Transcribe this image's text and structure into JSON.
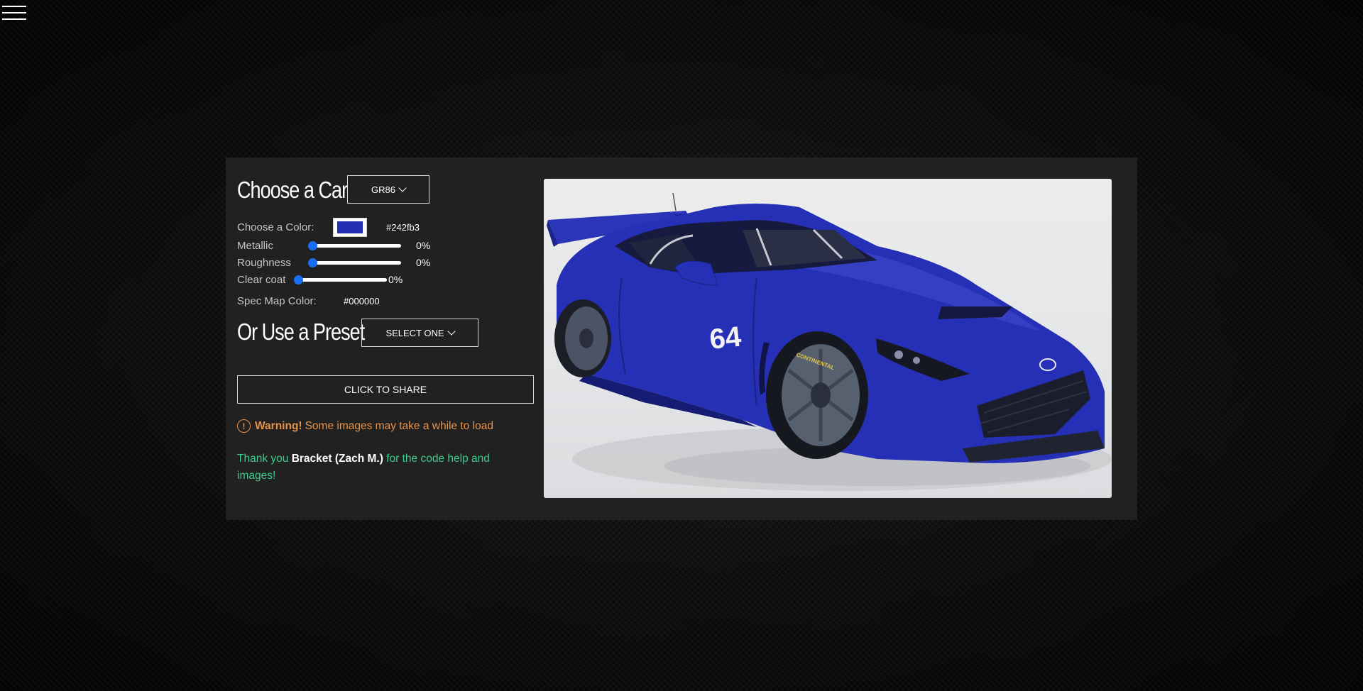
{
  "menu": {
    "icon": "hamburger-menu-icon"
  },
  "car": {
    "heading": "Choose a Car",
    "selected": "GR86"
  },
  "color": {
    "label": "Choose a Color:",
    "value": "#242fb3",
    "hex": "#242fb3"
  },
  "sliders": {
    "metallic": {
      "label": "Metallic",
      "value": "0%",
      "level": 0
    },
    "roughness": {
      "label": "Roughness",
      "value": "0%",
      "level": 0
    },
    "clearcoat": {
      "label": "Clear coat",
      "value": "0%",
      "level": 0
    }
  },
  "spec": {
    "label": "Spec Map Color:",
    "hex": "#000000"
  },
  "preset": {
    "heading": "Or Use a Preset",
    "selected": "SELECT ONE"
  },
  "share": {
    "label": "CLICK TO SHARE"
  },
  "warning": {
    "icon": "warning-icon",
    "icon_glyph": "!",
    "strong": "Warning!",
    "text": "Some images may take a while to load"
  },
  "thanks": {
    "pre": "Thank you",
    "name": "Bracket (Zach M.)",
    "post": "for the code help and images!"
  },
  "preview": {
    "car_number": "64",
    "tire_brand": "CONTINENTAL",
    "body_color": "#242fb3"
  },
  "colors": {
    "accent_blue": "#1a6ef5",
    "warning_orange": "#e7934a",
    "thanks_green": "#3fcc8e",
    "panel_bg": "#212121"
  }
}
